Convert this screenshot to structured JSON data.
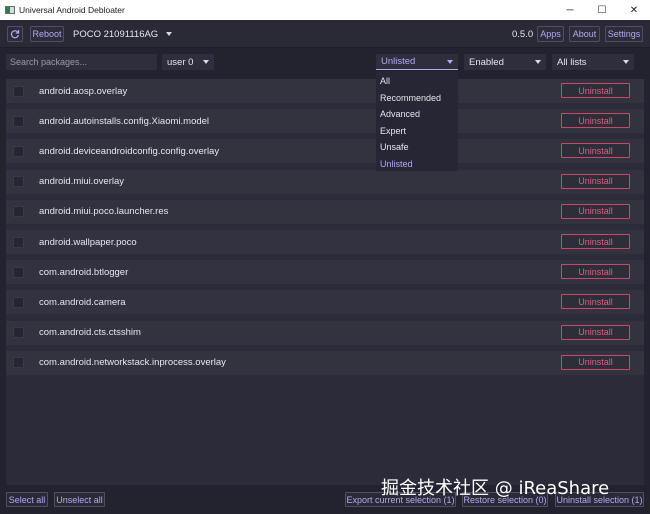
{
  "window": {
    "title": "Universal Android Debloater",
    "controls": [
      "─",
      "☐",
      "✕"
    ]
  },
  "toolbar": {
    "refresh_icon": "refresh-icon",
    "reboot_label": "Reboot",
    "device": "POCO 21091116AG",
    "version": "0.5.0",
    "apps_label": "Apps",
    "about_label": "About",
    "settings_label": "Settings"
  },
  "filters": {
    "search_placeholder": "Search packages...",
    "user": "user 0",
    "list_filter": "Unlisted",
    "state_filter": "Enabled",
    "list_source": "All lists"
  },
  "dropdown": {
    "options": [
      "All",
      "Recommended",
      "Advanced",
      "Expert",
      "Unsafe",
      "Unlisted"
    ],
    "selected": "Unlisted"
  },
  "packages": [
    {
      "name": "android.aosp.overlay",
      "action": "Uninstall"
    },
    {
      "name": "android.autoinstalls.config.Xiaomi.model",
      "action": "Uninstall"
    },
    {
      "name": "android.deviceandroidconfig.config.overlay",
      "action": "Uninstall"
    },
    {
      "name": "android.miui.overlay",
      "action": "Uninstall"
    },
    {
      "name": "android.miui.poco.launcher.res",
      "action": "Uninstall"
    },
    {
      "name": "android.wallpaper.poco",
      "action": "Uninstall"
    },
    {
      "name": "com.android.btlogger",
      "action": "Uninstall"
    },
    {
      "name": "com.android.camera",
      "action": "Uninstall"
    },
    {
      "name": "com.android.cts.ctsshim",
      "action": "Uninstall"
    },
    {
      "name": "com.android.networkstack.inprocess.overlay",
      "action": "Uninstall"
    }
  ],
  "bottom": {
    "select_all": "Select all",
    "unselect_all": "Unselect all",
    "export": "Export current selection (1)",
    "restore": "Restore selection (0)",
    "uninstall_selection": "Uninstall selection (1)"
  },
  "watermark": "掘金技术社区 @ iReaShare",
  "colors": {
    "background": "#23232f",
    "accent": "#b4a8f0",
    "danger": "#d8607e"
  }
}
